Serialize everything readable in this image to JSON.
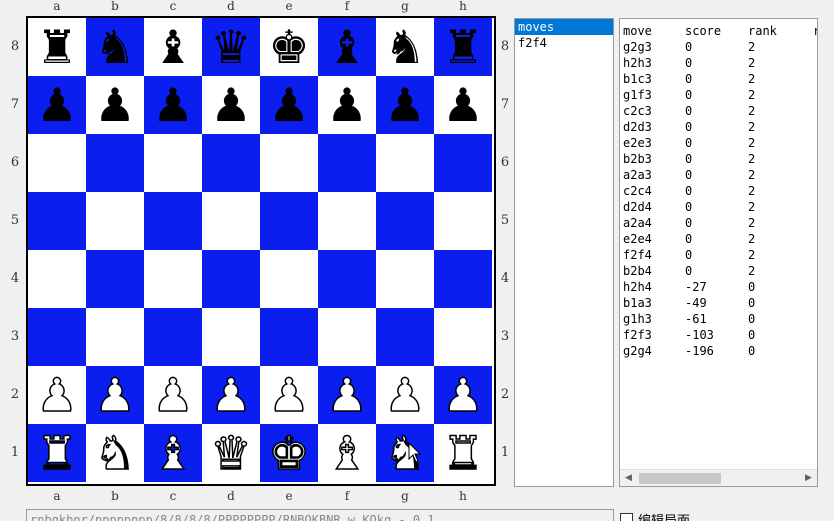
{
  "board": {
    "files": [
      "a",
      "b",
      "c",
      "d",
      "e",
      "f",
      "g",
      "h"
    ],
    "ranks": [
      "8",
      "7",
      "6",
      "5",
      "4",
      "3",
      "2",
      "1"
    ],
    "light_color": "#ffffff",
    "dark_color": "#0a1ef0",
    "pieces": [
      [
        "black-rook",
        "black-knight",
        "black-bishop",
        "black-queen",
        "black-king",
        "black-bishop",
        "black-knight",
        "black-rook"
      ],
      [
        "black-pawn",
        "black-pawn",
        "black-pawn",
        "black-pawn",
        "black-pawn",
        "black-pawn",
        "black-pawn",
        "black-pawn"
      ],
      [
        "",
        "",
        "",
        "",
        "",
        "",
        "",
        ""
      ],
      [
        "",
        "",
        "",
        "",
        "",
        "",
        "",
        ""
      ],
      [
        "",
        "",
        "",
        "",
        "",
        "",
        "",
        ""
      ],
      [
        "",
        "",
        "",
        "",
        "",
        "",
        "",
        ""
      ],
      [
        "white-pawn",
        "white-pawn",
        "white-pawn",
        "white-pawn",
        "white-pawn",
        "white-pawn",
        "white-pawn",
        "white-pawn"
      ],
      [
        "white-rook",
        "white-knight",
        "white-bishop",
        "white-queen",
        "white-king",
        "white-bishop",
        "white-knight",
        "white-rook"
      ]
    ]
  },
  "moves_list": {
    "items": [
      "moves",
      "f2f4"
    ],
    "selected_index": 0
  },
  "score_table": {
    "headers": [
      "move",
      "score",
      "rank",
      "r"
    ],
    "rows": [
      {
        "move": "g2g3",
        "score": "0",
        "rank": "2"
      },
      {
        "move": "h2h3",
        "score": "0",
        "rank": "2"
      },
      {
        "move": "b1c3",
        "score": "0",
        "rank": "2"
      },
      {
        "move": "g1f3",
        "score": "0",
        "rank": "2"
      },
      {
        "move": "c2c3",
        "score": "0",
        "rank": "2"
      },
      {
        "move": "d2d3",
        "score": "0",
        "rank": "2"
      },
      {
        "move": "e2e3",
        "score": "0",
        "rank": "2"
      },
      {
        "move": "b2b3",
        "score": "0",
        "rank": "2"
      },
      {
        "move": "a2a3",
        "score": "0",
        "rank": "2"
      },
      {
        "move": "c2c4",
        "score": "0",
        "rank": "2"
      },
      {
        "move": "d2d4",
        "score": "0",
        "rank": "2"
      },
      {
        "move": "a2a4",
        "score": "0",
        "rank": "2"
      },
      {
        "move": "e2e4",
        "score": "0",
        "rank": "2"
      },
      {
        "move": "f2f4",
        "score": "0",
        "rank": "2"
      },
      {
        "move": "b2b4",
        "score": "0",
        "rank": "2"
      },
      {
        "move": "h2h4",
        "score": "-27",
        "rank": "0"
      },
      {
        "move": "b1a3",
        "score": "-49",
        "rank": "0"
      },
      {
        "move": "g1h3",
        "score": "-61",
        "rank": "0"
      },
      {
        "move": "f2f3",
        "score": "-103",
        "rank": "0"
      },
      {
        "move": "g2g4",
        "score": "-196",
        "rank": "0"
      }
    ],
    "scroll_arrows": {
      "left": "◀",
      "right": "▶"
    }
  },
  "fen_input": {
    "value": "rnbqkbnr/pppppppp/8/8/8/8/PPPPPPPP/RNBQKBNR w KQkq - 0 1"
  },
  "edit_board_checkbox": {
    "label": "编辑局面",
    "checked": false
  }
}
